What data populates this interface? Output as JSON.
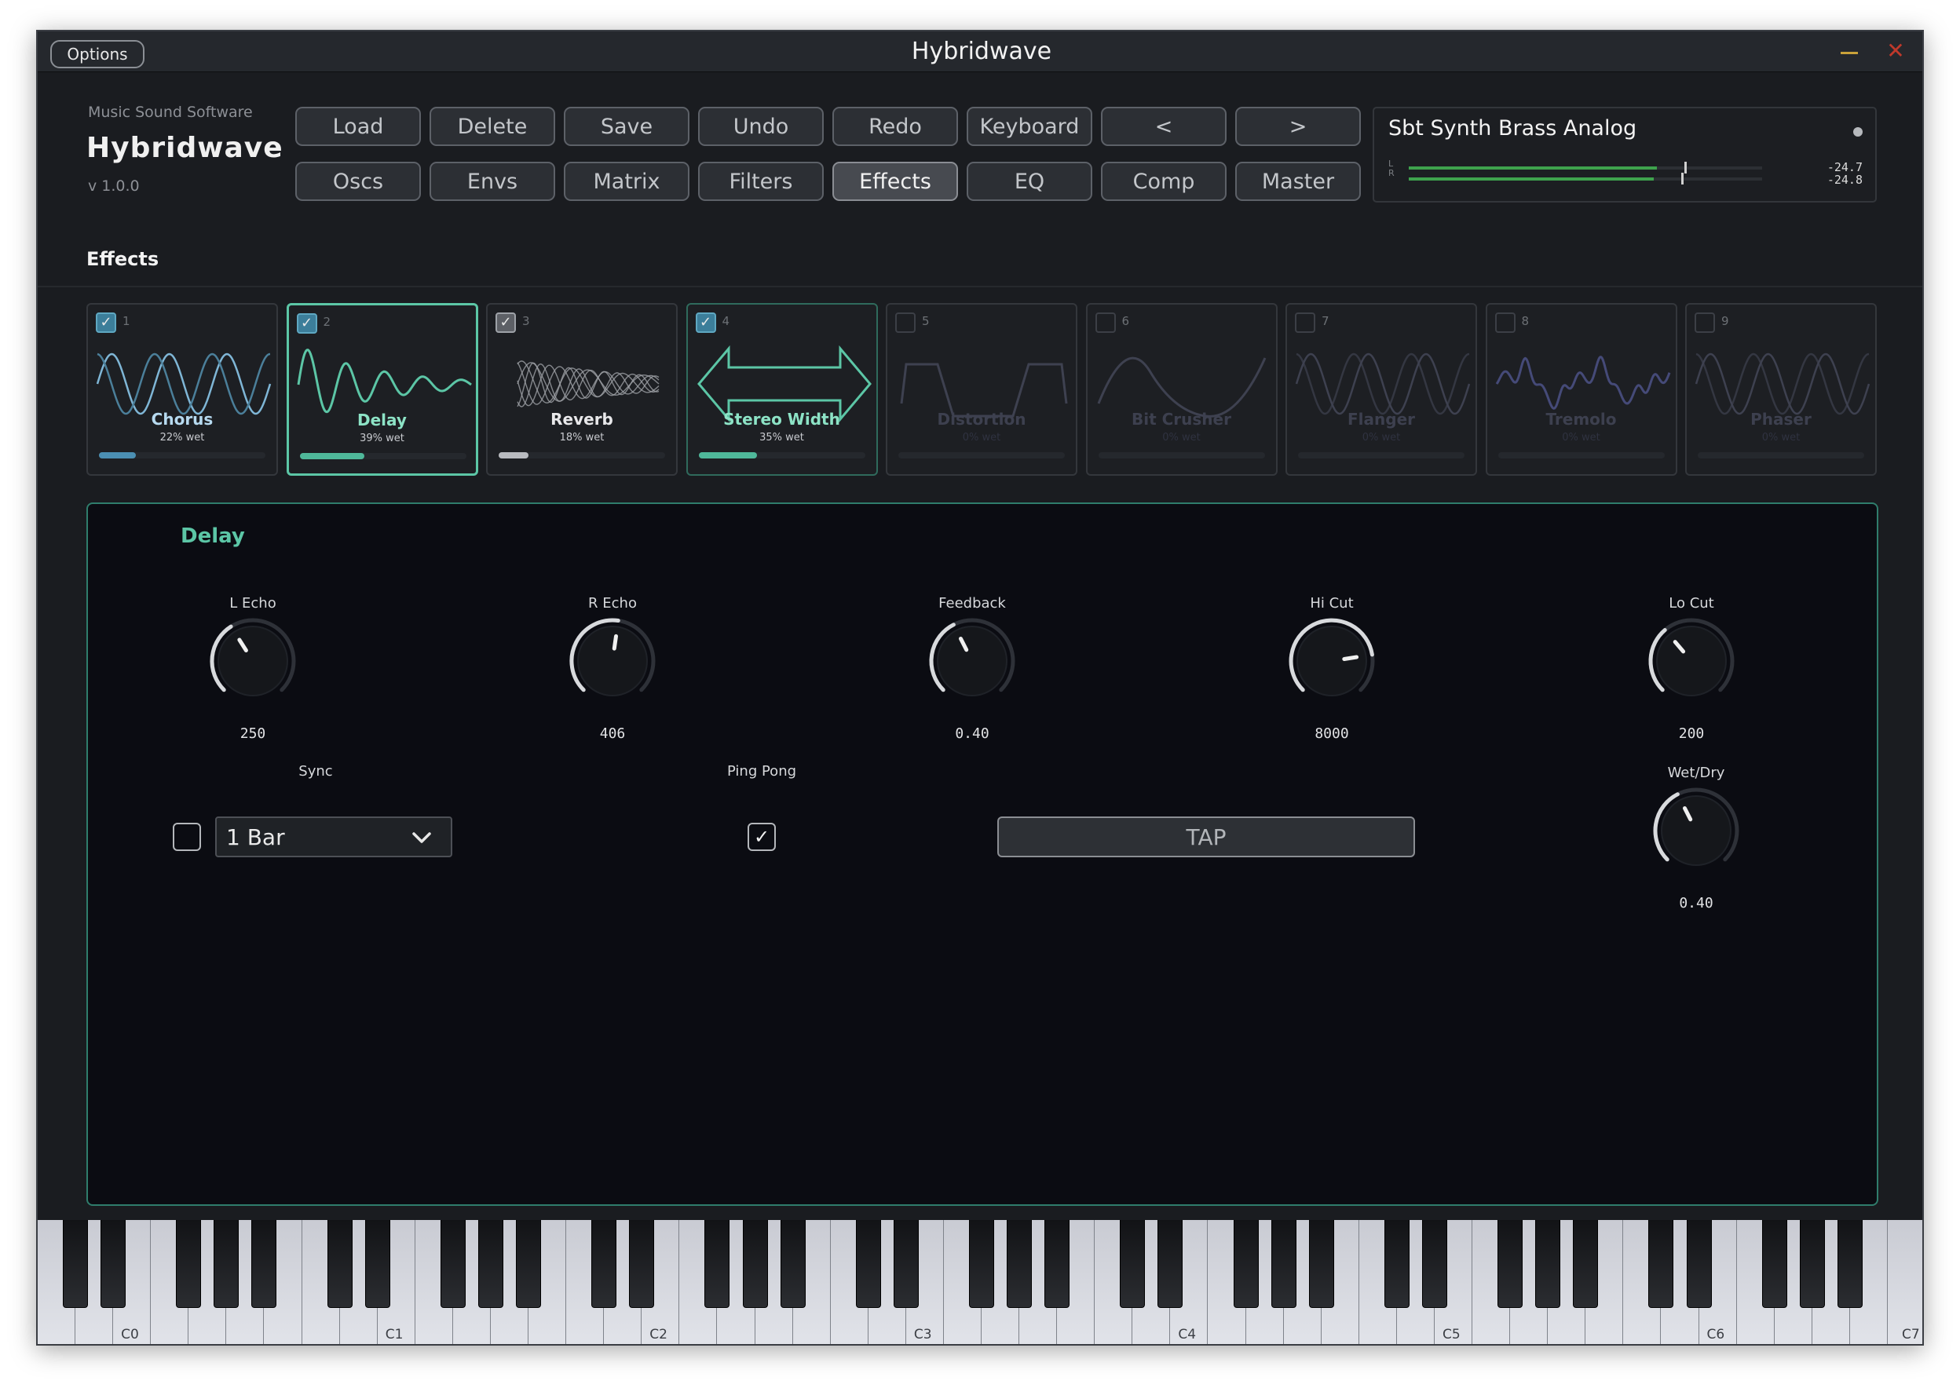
{
  "window": {
    "title": "Hybridwave",
    "options_label": "Options",
    "close_glyph": "✕"
  },
  "brand": {
    "subtitle": "Music Sound Software",
    "name": "Hybridwave",
    "version": "v 1.0.0"
  },
  "toolbar_row1": [
    "Load",
    "Delete",
    "Save",
    "Undo",
    "Redo",
    "Keyboard",
    "<",
    ">"
  ],
  "toolbar_row2": [
    "Oscs",
    "Envs",
    "Matrix",
    "Filters",
    "Effects",
    "EQ",
    "Comp",
    "Master"
  ],
  "active_tab": "Effects",
  "preset": {
    "name": "Sbt Synth Brass Analog",
    "meter_left_label": "L",
    "meter_right_label": "R",
    "meter_left_value": "-24.7",
    "meter_right_value": "-24.8",
    "meter_left_level": 0.78,
    "meter_right_level": 0.77
  },
  "section_title": "Effects",
  "effects": [
    {
      "num": "1",
      "name": "Chorus",
      "wet": "22% wet",
      "enabled": true,
      "wet_fraction": 0.22,
      "color": "#7fb6d6",
      "icon": "chorus-wave-icon"
    },
    {
      "num": "2",
      "name": "Delay",
      "wet": "39% wet",
      "enabled": true,
      "wet_fraction": 0.39,
      "color": "#5cc6a6",
      "icon": "delay-wave-icon"
    },
    {
      "num": "3",
      "name": "Reverb",
      "wet": "18% wet",
      "enabled": true,
      "wet_fraction": 0.18,
      "color": "#c8c8cc",
      "icon": "reverb-wave-icon"
    },
    {
      "num": "4",
      "name": "Stereo Width",
      "wet": "35% wet",
      "enabled": true,
      "wet_fraction": 0.35,
      "color": "#5cc6a6",
      "icon": "stereo-width-icon"
    },
    {
      "num": "5",
      "name": "Distortion",
      "wet": "0% wet",
      "enabled": false,
      "wet_fraction": 0,
      "color": "#3e4150",
      "icon": "distortion-wave-icon"
    },
    {
      "num": "6",
      "name": "Bit Crusher",
      "wet": "0% wet",
      "enabled": false,
      "wet_fraction": 0,
      "color": "#3e4150",
      "icon": "bit-crusher-wave-icon"
    },
    {
      "num": "7",
      "name": "Flanger",
      "wet": "0% wet",
      "enabled": false,
      "wet_fraction": 0,
      "color": "#3e4150",
      "icon": "flanger-wave-icon"
    },
    {
      "num": "8",
      "name": "Tremolo",
      "wet": "0% wet",
      "enabled": false,
      "wet_fraction": 0,
      "color": "#3e4150",
      "icon": "tremolo-wave-icon"
    },
    {
      "num": "9",
      "name": "Phaser",
      "wet": "0% wet",
      "enabled": false,
      "wet_fraction": 0,
      "color": "#3e4150",
      "icon": "phaser-wave-icon"
    }
  ],
  "selected_effect": "Delay",
  "delay_panel": {
    "title": "Delay",
    "knobs": [
      {
        "label": "L Echo",
        "value": "250",
        "position": 0.38
      },
      {
        "label": "R Echo",
        "value": "406",
        "position": 0.53
      },
      {
        "label": "Feedback",
        "value": "0.40",
        "position": 0.4
      },
      {
        "label": "Hi Cut",
        "value": "8000",
        "position": 0.8
      },
      {
        "label": "Lo Cut",
        "value": "200",
        "position": 0.35
      }
    ],
    "wet_dry": {
      "label": "Wet/Dry",
      "value": "0.40",
      "position": 0.4
    },
    "sync_label": "Sync",
    "sync_checked": false,
    "sync_value": "1 Bar",
    "ping_pong_label": "Ping Pong",
    "ping_pong_checked": true,
    "ping_pong_glyph": "✓",
    "tap_label": "TAP"
  },
  "keyboard": {
    "octave_labels": [
      "C0",
      "C1",
      "C2",
      "C3",
      "C4",
      "C5",
      "C6",
      "C7"
    ]
  },
  "colors": {
    "accent": "#5cc6a6",
    "meter_green": "#3ea24d",
    "close_red": "#c0392b",
    "minimize_yellow": "#c9a13a"
  }
}
